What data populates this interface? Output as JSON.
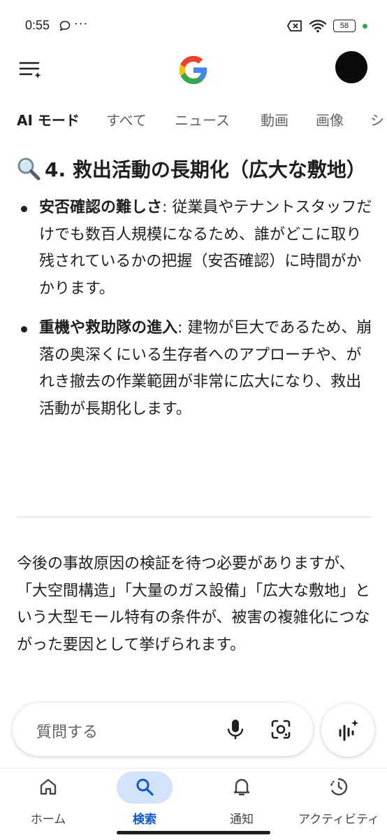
{
  "status_bar": {
    "time": "0:55",
    "more": "···",
    "battery": "58"
  },
  "tabs": [
    {
      "label": "AI モード",
      "active": true
    },
    {
      "label": "すべて",
      "active": false
    },
    {
      "label": "ニュース",
      "active": false
    },
    {
      "label": "動画",
      "active": false
    },
    {
      "label": "画像",
      "active": false
    },
    {
      "label": "シ",
      "active": false
    }
  ],
  "content": {
    "heading": "4. 救出活動の長期化（広大な敷地）",
    "bullets": [
      {
        "strong": "安否確認の難しさ",
        "text": ": 従業員やテナントスタッフだけでも数百人規模になるため、誰がどこに取り残されているかの把握（安否確認）に時間がかかります。"
      },
      {
        "strong": "重機や救助隊の進入",
        "text": ": 建物が巨大であるため、崩落の奥深くにいる生存者へのアプローチや、がれき撤去の作業範囲が非常に広大になり、救出活動が長期化します。"
      }
    ],
    "paragraph": "今後の事故原因の検証を待つ必要がありますが、「大空間構造」「大量のガス設備」「広大な敷地」という大型モール特有の条件が、被害の複雑化につながった要因として挙げられます。"
  },
  "search": {
    "placeholder": "質問する"
  },
  "bottom_nav": [
    {
      "label": "ホーム",
      "icon": "home-icon",
      "active": false
    },
    {
      "label": "検索",
      "icon": "search-icon",
      "active": true
    },
    {
      "label": "通知",
      "icon": "bell-icon",
      "active": false
    },
    {
      "label": "アクティビティ",
      "icon": "activity-icon",
      "active": false
    }
  ],
  "colors": {
    "accent": "#0b57d0",
    "active_pill": "#d3e3fd",
    "text": "#1f1f1f",
    "muted": "#5f6368"
  }
}
